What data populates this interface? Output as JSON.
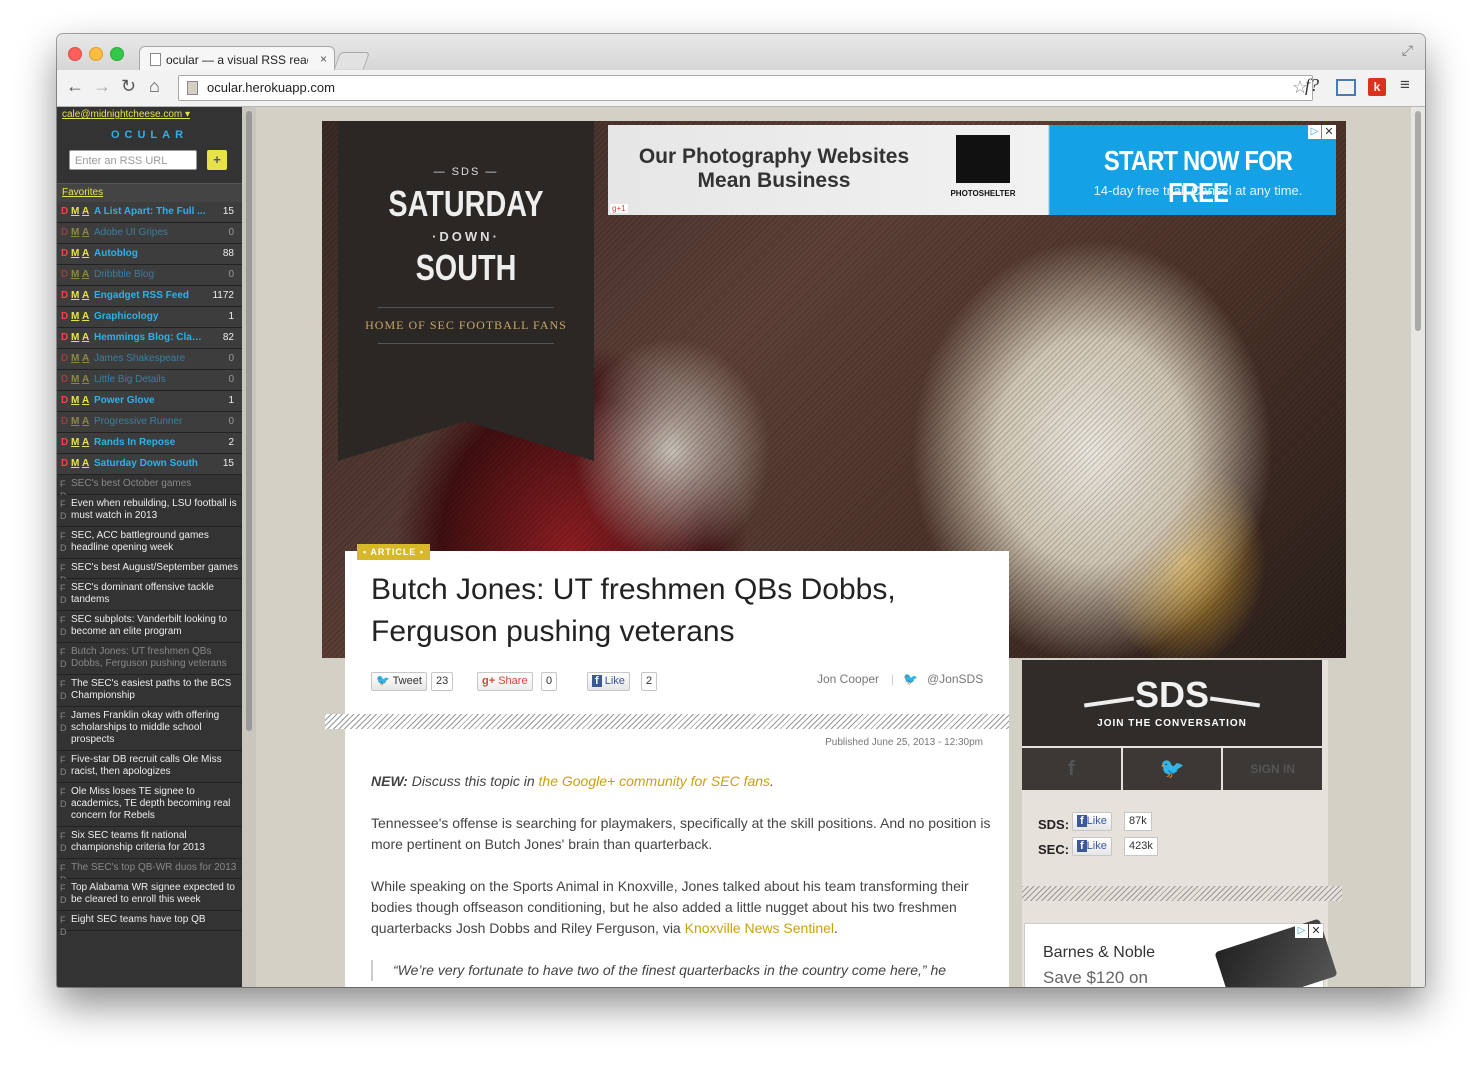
{
  "browser": {
    "tab_title": "ocular — a visual RSS reader",
    "tab_close": "×",
    "url": "ocular.herokuapp.com",
    "ext_fquery": "f?",
    "ext_k": "k"
  },
  "sidebar": {
    "account": "cale@midnightcheese.com ▾",
    "brand": "OCULAR",
    "rss_placeholder": "Enter an RSS URL",
    "add_label": "+",
    "favorites_label": "Favorites",
    "feeds": [
      {
        "name": "A List Apart: The Full ...",
        "count": "15",
        "active": true
      },
      {
        "name": "Adobe UI Gripes",
        "count": "0",
        "active": false
      },
      {
        "name": "Autoblog",
        "count": "88",
        "active": true
      },
      {
        "name": "Dribbble Blog",
        "count": "0",
        "active": false
      },
      {
        "name": "Engadget RSS Feed",
        "count": "1172",
        "active": true
      },
      {
        "name": "Graphicology",
        "count": "1",
        "active": true
      },
      {
        "name": "Hemmings Blog: Class...",
        "count": "82",
        "active": true
      },
      {
        "name": "James Shakespeare",
        "count": "0",
        "active": false
      },
      {
        "name": "Little Big Details",
        "count": "0",
        "active": false
      },
      {
        "name": "Power Glove",
        "count": "1",
        "active": true
      },
      {
        "name": "Progressive Runner",
        "count": "0",
        "active": false
      },
      {
        "name": "Rands In Repose",
        "count": "2",
        "active": true
      },
      {
        "name": "Saturday Down South",
        "count": "15",
        "active": true
      }
    ],
    "feed_flags": {
      "d": "D",
      "m": "M",
      "a": "A"
    },
    "articles": [
      {
        "title": "SEC's best October games",
        "read": true
      },
      {
        "title": "Even when rebuilding, LSU football is must watch in 2013",
        "read": false
      },
      {
        "title": "SEC, ACC battleground games headline opening week",
        "read": false
      },
      {
        "title": "SEC's best August/September games",
        "read": false
      },
      {
        "title": "SEC's dominant offensive tackle tandems",
        "read": false
      },
      {
        "title": "SEC subplots: Vanderbilt looking to become an elite program",
        "read": false
      },
      {
        "title": "Butch Jones: UT freshmen QBs Dobbs, Ferguson pushing veterans",
        "read": true
      },
      {
        "title": "The SEC's easiest paths to the BCS Championship",
        "read": false
      },
      {
        "title": "James Franklin okay with offering scholarships to middle school prospects",
        "read": false
      },
      {
        "title": "Five-star DB recruit calls Ole Miss racist, then apologizes",
        "read": false
      },
      {
        "title": "Ole Miss loses TE signee to academics, TE depth becoming real concern for Rebels",
        "read": false
      },
      {
        "title": "Six SEC teams fit national championship criteria for 2013",
        "read": false
      },
      {
        "title": "The SEC's top QB-WR duos for 2013",
        "read": true
      },
      {
        "title": "Top Alabama WR signee expected to be cleared to enroll this week",
        "read": false
      },
      {
        "title": "Eight SEC teams have top QB",
        "read": false
      }
    ],
    "article_flags": "F D"
  },
  "site": {
    "logo": {
      "sds": "— SDS —",
      "saturday": "SATURDAY",
      "down": "·DOWN·",
      "south": "SOUTH",
      "tagline": "HOME OF SEC FOOTBALL FANS"
    },
    "ad": {
      "headline": "Our Photography Websites Mean Business",
      "brand": "PHOTOSHELTER",
      "cta": "START NOW FOR FREE",
      "sub": "14-day free trial. Cancel at any time.",
      "gplus": "g+1",
      "close": "✕",
      "adchoices": "▷"
    },
    "article": {
      "badge": "• ARTICLE •",
      "headline": "Butch Jones: UT freshmen QBs Dobbs, Ferguson pushing veterans",
      "tweet_label": "Tweet",
      "tweet_count": "23",
      "share_label": "Share",
      "share_count": "0",
      "like_label": "Like",
      "like_count": "2",
      "author": "Jon Cooper",
      "twitter_handle": "@JonSDS",
      "published": "Published June 25, 2013 - 12:30pm",
      "new_label": "NEW:",
      "new_text": " Discuss this topic in ",
      "new_link": "the Google+ community for SEC fans",
      "p1": "Tennessee's offense is searching for playmakers, specifically at the skill positions. And no position is more pertinent on Butch Jones' brain than quarterback.",
      "p2_text": "While speaking on the Sports Animal in Knoxville, Jones talked about his team transforming their bodies though offseason conditioning, but he also added a little nugget about his two freshmen quarterbacks Josh Dobbs and Riley Ferguson, via ",
      "p2_link": "Knoxville News Sentinel",
      "quote": "“We’re very fortunate to have two of the finest quarterbacks in the country come here,” he"
    },
    "rail": {
      "sds": "SDS",
      "join": "JOIN THE CONVERSATION",
      "sign_in": "SIGN IN",
      "sds_label": "SDS:",
      "sds_likes": "87k",
      "sec_label": "SEC:",
      "sec_likes": "423k",
      "like_label": "Like",
      "bn_title": "Barnes & Noble",
      "bn_sub": "Save $120 on"
    }
  },
  "colors": {
    "ocular_blue": "#2fb0e8",
    "ocular_yellow": "#e8e24a",
    "flag_red": "#ff4040",
    "link_gold": "#c9a10f",
    "ad_blue": "#14a1e6"
  }
}
